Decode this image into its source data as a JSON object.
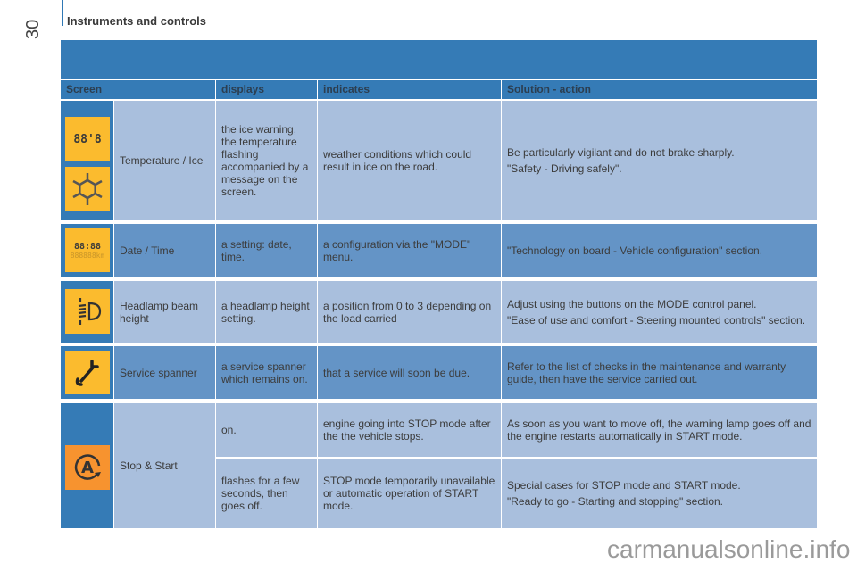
{
  "page": {
    "number": "30",
    "section_title": "Instruments and controls",
    "watermark": "carmanualsonline.info"
  },
  "colors": {
    "banner": "#357bb6",
    "row_light": "#a9bfdd",
    "row_dark": "#6494c6",
    "icon_yellow": "#fbbb2e",
    "icon_orange": "#f7932f"
  },
  "table": {
    "headers": [
      "Screen",
      "displays",
      "indicates",
      "Solution - action"
    ],
    "rows": [
      {
        "icons": [
          "temperature-display-icon",
          "snowflake-icon"
        ],
        "icon_text": "88'8",
        "screen": "Temperature / Ice",
        "displays": "the ice warning, the temperature flashing accompanied by a message on the screen.",
        "indicates": "weather conditions which could result in ice on the road.",
        "solution": [
          "Be particularly vigilant and do not brake sharply.",
          "\"Safety - Driving safely\"."
        ]
      },
      {
        "icons": [
          "date-time-display-icon"
        ],
        "icon_text": "88:88",
        "icon_text2": "888888km",
        "screen": "Date / Time",
        "displays": "a setting: date, time.",
        "indicates": "a configuration via the \"MODE\" menu.",
        "solution": [
          "\"Technology on board - Vehicle configuration\" section."
        ]
      },
      {
        "icons": [
          "headlamp-beam-height-icon"
        ],
        "screen": "Headlamp beam height",
        "displays": "a headlamp height setting.",
        "indicates": "a position from 0 to 3 depending on the load carried",
        "solution": [
          "Adjust using the buttons on the MODE control panel.",
          "\"Ease of use and comfort - Steering mounted controls\" section."
        ]
      },
      {
        "icons": [
          "service-spanner-icon"
        ],
        "screen": "Service spanner",
        "displays": "a service spanner which remains on.",
        "indicates": "that a service will soon be due.",
        "solution": [
          "Refer to the list of checks in the maintenance and warranty guide, then have the service carried out."
        ]
      },
      {
        "icons": [
          "stop-start-icon"
        ],
        "icon_text": "A",
        "screen": "Stop & Start",
        "sub": [
          {
            "displays": "on.",
            "indicates": "engine going into STOP mode after the the vehicle stops.",
            "solution": [
              "As soon as you want to move off, the warning lamp goes off and the engine restarts automatically in START mode."
            ]
          },
          {
            "displays": "flashes for a few seconds, then goes off.",
            "indicates": "STOP mode temporarily unavailable or automatic operation of START mode.",
            "solution": [
              "Special cases for STOP mode and START mode.",
              "\"Ready to go - Starting and stopping\" section."
            ]
          }
        ]
      }
    ]
  }
}
